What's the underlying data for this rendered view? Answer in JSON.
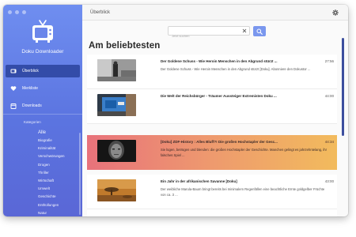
{
  "app": {
    "title": "Doku Downloader",
    "logo_icon": "tv-icon",
    "accent_color": "#5b74e0"
  },
  "sidebar": {
    "nav": [
      {
        "label": "Überblick",
        "icon": "tv-small-icon",
        "active": true
      },
      {
        "label": "Merkliste",
        "icon": "heart-icon",
        "active": false
      },
      {
        "label": "Downloads",
        "icon": "calendar-icon",
        "active": false
      }
    ],
    "categories_heading": "Kategorien",
    "categories": [
      "Alle",
      "Biografie",
      "Kriminalität",
      "Verschwörungen",
      "Drogen",
      "Thriller",
      "Wirtschaft",
      "Umwelt",
      "Geschichte",
      "Enthüllungen",
      "Natur"
    ]
  },
  "header": {
    "title": "Überblick",
    "settings_icon": "gear-icon"
  },
  "search": {
    "placeholder": "Jetzt suchen",
    "value": "",
    "clear_icon": "close-icon",
    "button_icon": "search-icon"
  },
  "main": {
    "section_title": "Am beliebtesten",
    "highlight_colors": [
      "#e8727b",
      "#f2bb5d"
    ],
    "items": [
      {
        "title": "Der Goldene Schuss - Wie Heroin Menschen in den Abgrund stürzt ...",
        "description": "Der Goldene Schuss - Wie Heroin Menschen in den Abgrund stürzt [Doku]. Abonniere den Dokustor ...",
        "duration": "27:56",
        "highlighted": false
      },
      {
        "title": "Die Welt der Reichsbürger - Träumer Aussteiger Extremisten Doku ...",
        "description": "",
        "duration": "44:00",
        "highlighted": false
      },
      {
        "title": "[Doku] ZDF-History : Alles Bluff?! Die großen Hochstapler der Gesc...",
        "description": "Sie lügen, betrügen und blenden: die großen Hochstapler der Geschichte. Manchen gelingt es jahrzehntelang, ihr falsches Spiel ...",
        "duration": "44:34",
        "highlighted": true
      },
      {
        "title": "Ein Jahr in der afrikanischen Savanne [Doku]",
        "description": "Der weibliche Marula-Baum bringt bereits bei minimalem Regenfällen eine beachtliche Ernte goldgelber Früchte von ca. 3 ...",
        "duration": "43:00",
        "highlighted": false
      }
    ]
  }
}
